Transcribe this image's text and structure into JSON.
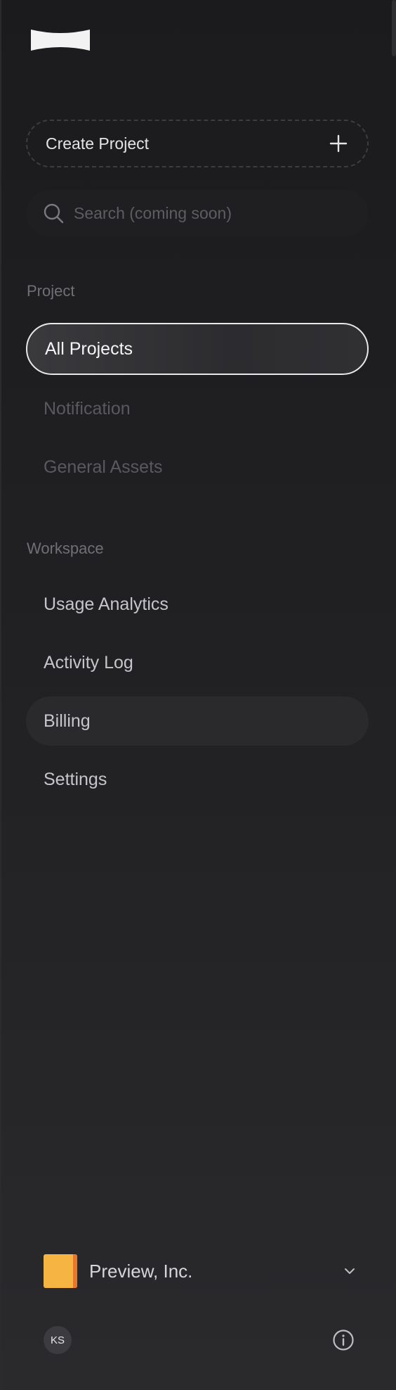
{
  "app": {
    "logo_icon": "brand-logo-icon"
  },
  "create_project": {
    "label": "Create Project",
    "icon": "plus-icon"
  },
  "search": {
    "placeholder": "Search (coming soon)",
    "value": "",
    "icon": "search-icon"
  },
  "sections": {
    "project": {
      "label": "Project",
      "items": [
        {
          "label": "All Projects",
          "state": "active"
        },
        {
          "label": "Notification",
          "state": "disabled"
        },
        {
          "label": "General Assets",
          "state": "disabled"
        }
      ]
    },
    "workspace": {
      "label": "Workspace",
      "items": [
        {
          "label": "Usage Analytics",
          "state": "normal"
        },
        {
          "label": "Activity Log",
          "state": "normal"
        },
        {
          "label": "Billing",
          "state": "hover"
        },
        {
          "label": "Settings",
          "state": "normal"
        }
      ]
    }
  },
  "workspace_switcher": {
    "name": "Preview, Inc.",
    "logo_color": "#f6b443",
    "logo_accent": "#e7772a",
    "icon": "chevron-down-icon"
  },
  "user": {
    "initials": "KS",
    "info_icon": "info-icon"
  },
  "colors": {
    "background": "#1b1b1d",
    "active_border": "#e8e8ea",
    "text_primary": "#f5f5f7",
    "text_disabled": "#59595e"
  }
}
